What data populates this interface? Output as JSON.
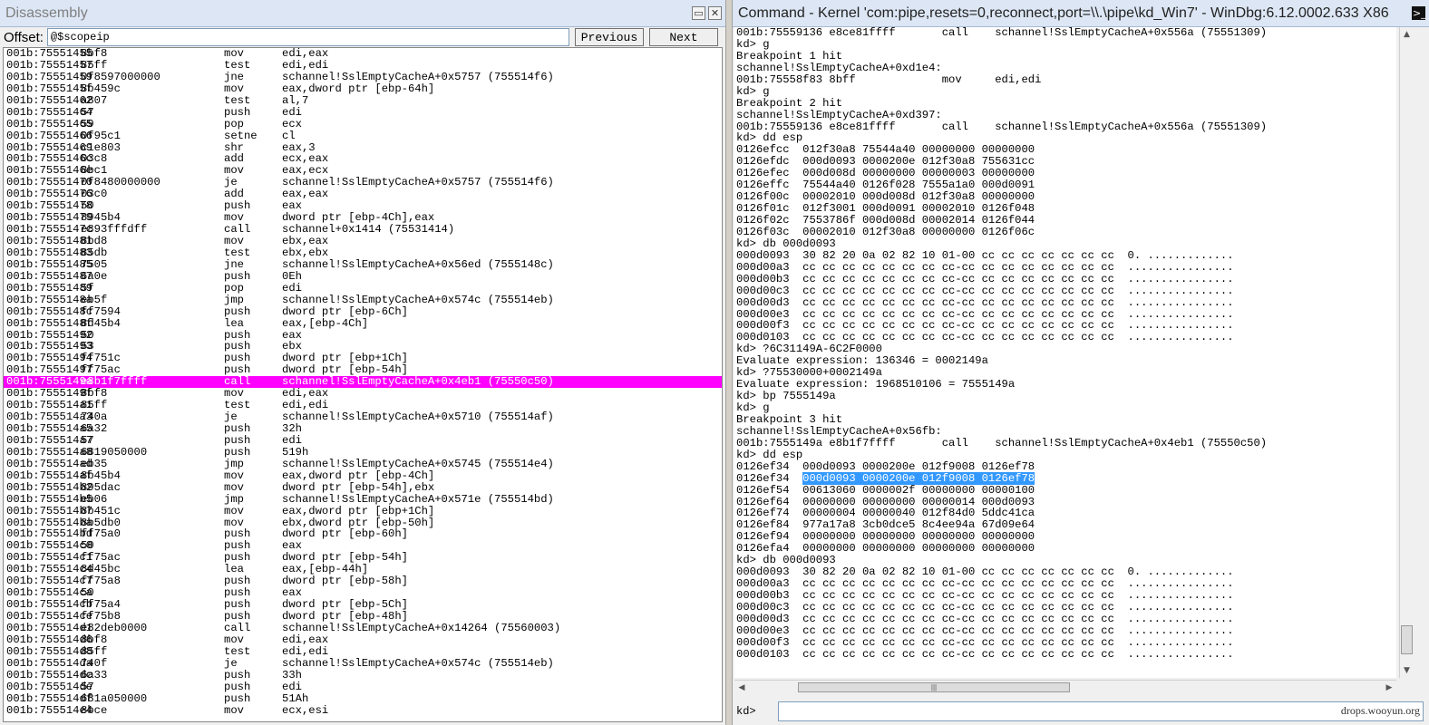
{
  "disassembly": {
    "title": "Disassembly",
    "offset_label": "Offset:",
    "offset_value": "@$scopeip",
    "previous_label": "Previous",
    "next_label": "Next",
    "lines": [
      {
        "addr": "001b:75551455",
        "bytes": "8bf8",
        "mn": "mov",
        "op": "edi,eax"
      },
      {
        "addr": "001b:75551457",
        "bytes": "85ff",
        "mn": "test",
        "op": "edi,edi"
      },
      {
        "addr": "001b:75551459",
        "bytes": "0f8597000000",
        "mn": "jne",
        "op": "schannel!SslEmptyCacheA+0x5757 (755514f6)"
      },
      {
        "addr": "001b:7555145f",
        "bytes": "8b459c",
        "mn": "mov",
        "op": "eax,dword ptr [ebp-64h]"
      },
      {
        "addr": "001b:75551462",
        "bytes": "a807",
        "mn": "test",
        "op": "al,7"
      },
      {
        "addr": "001b:75551464",
        "bytes": "57",
        "mn": "push",
        "op": "edi"
      },
      {
        "addr": "001b:75551465",
        "bytes": "59",
        "mn": "pop",
        "op": "ecx"
      },
      {
        "addr": "001b:75551466",
        "bytes": "0f95c1",
        "mn": "setne",
        "op": "cl"
      },
      {
        "addr": "001b:75551469",
        "bytes": "c1e803",
        "mn": "shr",
        "op": "eax,3"
      },
      {
        "addr": "001b:7555146c",
        "bytes": "03c8",
        "mn": "add",
        "op": "ecx,eax"
      },
      {
        "addr": "001b:7555146e",
        "bytes": "8bc1",
        "mn": "mov",
        "op": "eax,ecx"
      },
      {
        "addr": "001b:75551470",
        "bytes": "0f8480000000",
        "mn": "je",
        "op": "schannel!SslEmptyCacheA+0x5757 (755514f6)"
      },
      {
        "addr": "001b:75551476",
        "bytes": "03c0",
        "mn": "add",
        "op": "eax,eax"
      },
      {
        "addr": "001b:75551478",
        "bytes": "50",
        "mn": "push",
        "op": "eax"
      },
      {
        "addr": "001b:75551479",
        "bytes": "8945b4",
        "mn": "mov",
        "op": "dword ptr [ebp-4Ch],eax"
      },
      {
        "addr": "001b:7555147c",
        "bytes": "e893fffdff",
        "mn": "call",
        "op": "schannel+0x1414 (75531414)"
      },
      {
        "addr": "001b:75551481",
        "bytes": "8bd8",
        "mn": "mov",
        "op": "ebx,eax"
      },
      {
        "addr": "001b:75551483",
        "bytes": "85db",
        "mn": "test",
        "op": "ebx,ebx"
      },
      {
        "addr": "001b:75551485",
        "bytes": "7505",
        "mn": "jne",
        "op": "schannel!SslEmptyCacheA+0x56ed (7555148c)"
      },
      {
        "addr": "001b:75551487",
        "bytes": "6a0e",
        "mn": "push",
        "op": "0Eh"
      },
      {
        "addr": "001b:75551489",
        "bytes": "5f",
        "mn": "pop",
        "op": "edi"
      },
      {
        "addr": "001b:7555148a",
        "bytes": "eb5f",
        "mn": "jmp",
        "op": "schannel!SslEmptyCacheA+0x574c (755514eb)"
      },
      {
        "addr": "001b:7555148c",
        "bytes": "ff7594",
        "mn": "push",
        "op": "dword ptr [ebp-6Ch]"
      },
      {
        "addr": "001b:7555148f",
        "bytes": "8d45b4",
        "mn": "lea",
        "op": "eax,[ebp-4Ch]"
      },
      {
        "addr": "001b:75551492",
        "bytes": "50",
        "mn": "push",
        "op": "eax"
      },
      {
        "addr": "001b:75551493",
        "bytes": "53",
        "mn": "push",
        "op": "ebx"
      },
      {
        "addr": "001b:75551494",
        "bytes": "ff751c",
        "mn": "push",
        "op": "dword ptr [ebp+1Ch]"
      },
      {
        "addr": "001b:75551497",
        "bytes": "ff75ac",
        "mn": "push",
        "op": "dword ptr [ebp-54h]"
      },
      {
        "addr": "001b:7555149a",
        "bytes": "e8b1f7ffff",
        "mn": "call",
        "op": "schannel!SslEmptyCacheA+0x4eb1 (75550c50)"
      },
      {
        "addr": "001b:7555149f",
        "bytes": "8bf8",
        "mn": "mov",
        "op": "edi,eax"
      },
      {
        "addr": "001b:755514a1",
        "bytes": "85ff",
        "mn": "test",
        "op": "edi,edi"
      },
      {
        "addr": "001b:755514a3",
        "bytes": "740a",
        "mn": "je",
        "op": "schannel!SslEmptyCacheA+0x5710 (755514af)"
      },
      {
        "addr": "001b:755514a5",
        "bytes": "6a32",
        "mn": "push",
        "op": "32h"
      },
      {
        "addr": "001b:755514a7",
        "bytes": "57",
        "mn": "push",
        "op": "edi"
      },
      {
        "addr": "001b:755514a8",
        "bytes": "6819050000",
        "mn": "push",
        "op": "519h"
      },
      {
        "addr": "001b:755514ad",
        "bytes": "eb35",
        "mn": "jmp",
        "op": "schannel!SslEmptyCacheA+0x5745 (755514e4)"
      },
      {
        "addr": "001b:755514af",
        "bytes": "8b45b4",
        "mn": "mov",
        "op": "eax,dword ptr [ebp-4Ch]"
      },
      {
        "addr": "001b:755514b2",
        "bytes": "895dac",
        "mn": "mov",
        "op": "dword ptr [ebp-54h],ebx"
      },
      {
        "addr": "001b:755514b5",
        "bytes": "eb06",
        "mn": "jmp",
        "op": "schannel!SslEmptyCacheA+0x571e (755514bd)"
      },
      {
        "addr": "001b:755514b7",
        "bytes": "8b451c",
        "mn": "mov",
        "op": "eax,dword ptr [ebp+1Ch]"
      },
      {
        "addr": "001b:755514ba",
        "bytes": "8b5db0",
        "mn": "mov",
        "op": "ebx,dword ptr [ebp-50h]"
      },
      {
        "addr": "001b:755514bd",
        "bytes": "ff75a0",
        "mn": "push",
        "op": "dword ptr [ebp-60h]"
      },
      {
        "addr": "001b:755514c0",
        "bytes": "50",
        "mn": "push",
        "op": "eax"
      },
      {
        "addr": "001b:755514c1",
        "bytes": "ff75ac",
        "mn": "push",
        "op": "dword ptr [ebp-54h]"
      },
      {
        "addr": "001b:755514c4",
        "bytes": "8d45bc",
        "mn": "lea",
        "op": "eax,[ebp-44h]"
      },
      {
        "addr": "001b:755514c7",
        "bytes": "ff75a8",
        "mn": "push",
        "op": "dword ptr [ebp-58h]"
      },
      {
        "addr": "001b:755514ca",
        "bytes": "50",
        "mn": "push",
        "op": "eax"
      },
      {
        "addr": "001b:755514cb",
        "bytes": "ff75a4",
        "mn": "push",
        "op": "dword ptr [ebp-5Ch]"
      },
      {
        "addr": "001b:755514ce",
        "bytes": "ff75b8",
        "mn": "push",
        "op": "dword ptr [ebp-48h]"
      },
      {
        "addr": "001b:755514d1",
        "bytes": "e82deb0000",
        "mn": "call",
        "op": "schannel!SslEmptyCacheA+0x14264 (75560003)"
      },
      {
        "addr": "001b:755514d6",
        "bytes": "8bf8",
        "mn": "mov",
        "op": "edi,eax"
      },
      {
        "addr": "001b:755514d8",
        "bytes": "85ff",
        "mn": "test",
        "op": "edi,edi"
      },
      {
        "addr": "001b:755514da",
        "bytes": "740f",
        "mn": "je",
        "op": "schannel!SslEmptyCacheA+0x574c (755514eb)"
      },
      {
        "addr": "001b:755514dc",
        "bytes": "6a33",
        "mn": "push",
        "op": "33h"
      },
      {
        "addr": "001b:755514de",
        "bytes": "57",
        "mn": "push",
        "op": "edi"
      },
      {
        "addr": "001b:755514df",
        "bytes": "681a050000",
        "mn": "push",
        "op": "51Ah"
      },
      {
        "addr": "001b:755514e4",
        "bytes": "8bce",
        "mn": "mov",
        "op": "ecx,esi"
      }
    ],
    "highlight_index": 28
  },
  "command": {
    "title": "Command - Kernel 'com:pipe,resets=0,reconnect,port=\\\\.\\pipe\\kd_Win7' - WinDbg:6.12.0002.633 X86",
    "prompt_label": "kd>",
    "watermark": "drops.wooyun.org",
    "lines": [
      "001b:75559136 e8ce81ffff       call    schannel!SslEmptyCacheA+0x556a (75551309)",
      "kd> g",
      "Breakpoint 1 hit",
      "schannel!SslEmptyCacheA+0xd1e4:",
      "001b:75558f83 8bff             mov     edi,edi",
      "kd> g",
      "Breakpoint 2 hit",
      "schannel!SslEmptyCacheA+0xd397:",
      "001b:75559136 e8ce81ffff       call    schannel!SslEmptyCacheA+0x556a (75551309)",
      "kd> dd esp",
      "0126efcc  012f30a8 75544a40 00000000 00000000",
      "0126efdc  000d0093 0000200e 012f30a8 755631cc",
      "0126efec  000d008d 00000000 00000003 00000000",
      "0126effc  75544a40 0126f028 7555a1a0 000d0091",
      "0126f00c  00002010 000d008d 012f30a8 00000000",
      "0126f01c  012f3001 000d0091 00002010 0126f048",
      "0126f02c  7553786f 000d008d 00002014 0126f044",
      "0126f03c  00002010 012f30a8 00000000 0126f06c",
      "kd> db 000d0093",
      "000d0093  30 82 20 0a 02 82 10 01-00 cc cc cc cc cc cc cc  0. .............",
      "000d00a3  cc cc cc cc cc cc cc cc-cc cc cc cc cc cc cc cc  ................",
      "000d00b3  cc cc cc cc cc cc cc cc-cc cc cc cc cc cc cc cc  ................",
      "000d00c3  cc cc cc cc cc cc cc cc-cc cc cc cc cc cc cc cc  ................",
      "000d00d3  cc cc cc cc cc cc cc cc-cc cc cc cc cc cc cc cc  ................",
      "000d00e3  cc cc cc cc cc cc cc cc-cc cc cc cc cc cc cc cc  ................",
      "000d00f3  cc cc cc cc cc cc cc cc-cc cc cc cc cc cc cc cc  ................",
      "000d0103  cc cc cc cc cc cc cc cc-cc cc cc cc cc cc cc cc  ................",
      "kd> ?6C31149A-6C2F0000",
      "Evaluate expression: 136346 = 0002149a",
      "kd> ?75530000+0002149a",
      "Evaluate expression: 1968510106 = 7555149a",
      "kd> bp 7555149a",
      "kd> g",
      "Breakpoint 3 hit",
      "schannel!SslEmptyCacheA+0x56fb:",
      "001b:7555149a e8b1f7ffff       call    schannel!SslEmptyCacheA+0x4eb1 (75550c50)",
      "kd> dd esp",
      "0126ef34  000d0093 0000200e 012f9008 0126ef78",
      "0126ef44  0000002f 012f30a8 000d0093 755631cc",
      "0126ef54  00613060 0000002f 00000000 00000100",
      "0126ef64  00000000 00000000 00000014 000d0093",
      "0126ef74  00000004 00000040 012f84d0 5ddc41ca",
      "0126ef84  977a17a8 3cb0dce5 8c4ee94a 67d09e64",
      "0126ef94  00000000 00000000 00000000 00000000",
      "0126efa4  00000000 00000000 00000000 00000000",
      "kd> db 000d0093",
      "000d0093  30 82 20 0a 02 82 10 01-00 cc cc cc cc cc cc cc  0. .............",
      "000d00a3  cc cc cc cc cc cc cc cc-cc cc cc cc cc cc cc cc  ................",
      "000d00b3  cc cc cc cc cc cc cc cc-cc cc cc cc cc cc cc cc  ................",
      "000d00c3  cc cc cc cc cc cc cc cc-cc cc cc cc cc cc cc cc  ................",
      "000d00d3  cc cc cc cc cc cc cc cc-cc cc cc cc cc cc cc cc  ................",
      "000d00e3  cc cc cc cc cc cc cc cc-cc cc cc cc cc cc cc cc  ................",
      "000d00f3  cc cc cc cc cc cc cc cc-cc cc cc cc cc cc cc cc  ................",
      "000d0103  cc cc cc cc cc cc cc cc-cc cc cc cc cc cc cc cc  ................"
    ],
    "selection": {
      "line_index": 38,
      "prefix": "0126ef34  ",
      "selected": "000d0093 0000200e 012f9008 0126ef78"
    }
  }
}
